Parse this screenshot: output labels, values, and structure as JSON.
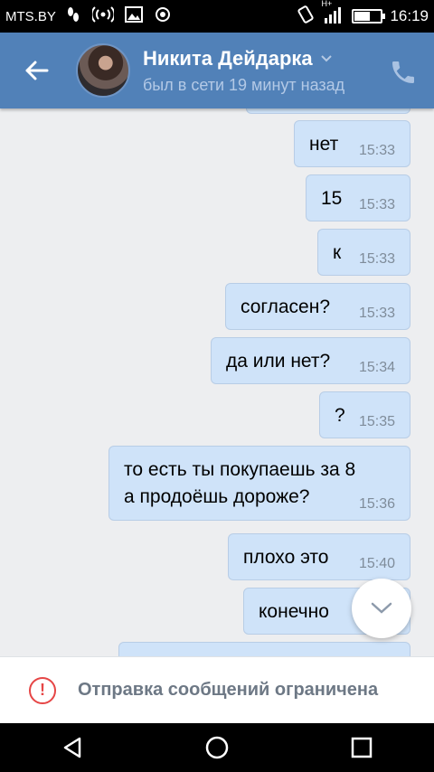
{
  "status_bar": {
    "carrier": "MTS.BY",
    "left_icons": [
      "footprint-icon",
      "hotspot-icon",
      "image-icon",
      "sync-icon"
    ],
    "right_icons": [
      "vibrate-icon",
      "signal-icon"
    ],
    "network_type": "H+",
    "battery_level_percent": 55,
    "time": "16:19"
  },
  "header": {
    "name": "Никита Дейдарка",
    "last_seen": "был в сети 19 минут назад",
    "background_color": "#5181b8"
  },
  "messages": [
    {
      "text": "нет",
      "time": "15:33"
    },
    {
      "text": "15",
      "time": "15:33"
    },
    {
      "text": "к",
      "time": "15:33"
    },
    {
      "text": "согласен?",
      "time": "15:33"
    },
    {
      "text": "да или нет?",
      "time": "15:34"
    },
    {
      "text": "?",
      "time": "15:35"
    },
    {
      "text": "то есть ты покупаешь за 8\nа продоёшь дороже?",
      "time": "15:36"
    },
    {
      "text": "плохо это",
      "time": "15:40"
    },
    {
      "text": "конечно",
      "time": ""
    }
  ],
  "restriction": {
    "label": "Отправка сообщений ограничена",
    "icon_color": "#e64646"
  },
  "nav": [
    "back-icon",
    "home-icon",
    "recents-icon"
  ]
}
